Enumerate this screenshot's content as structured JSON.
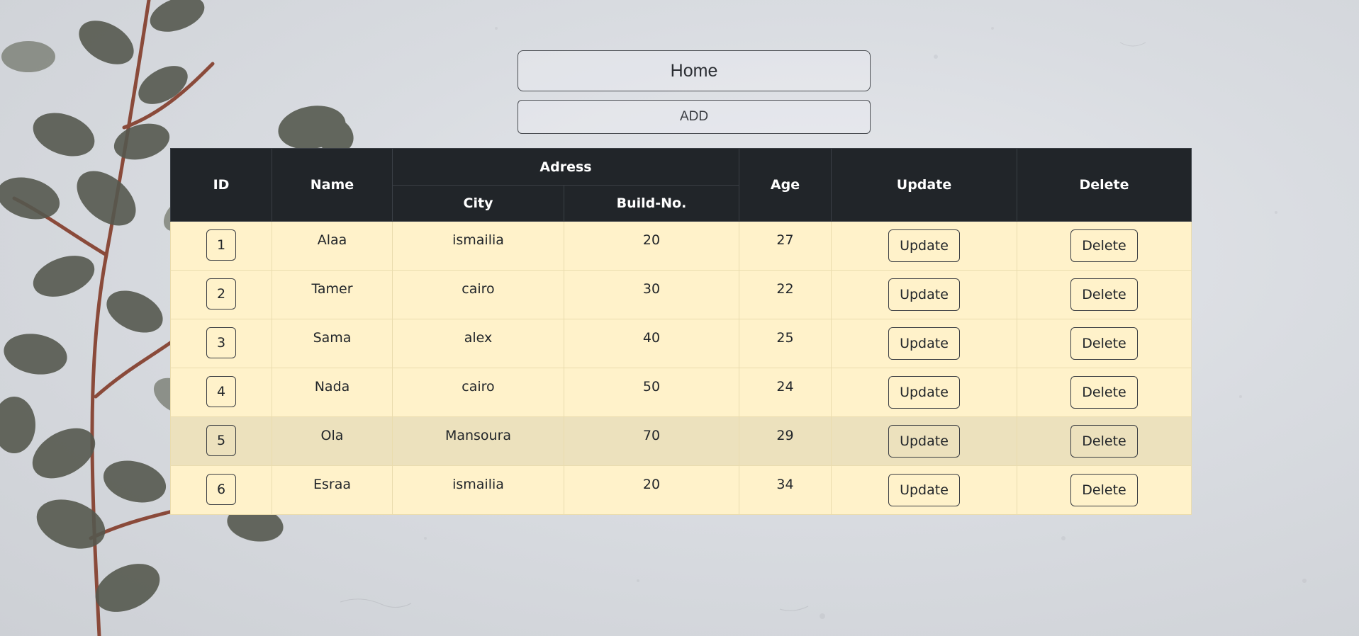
{
  "home_label": "Home",
  "add_label": "ADD",
  "table": {
    "headers": {
      "id": "ID",
      "name": "Name",
      "address": "Adress",
      "city": "City",
      "build_no": "Build-No.",
      "age": "Age",
      "update": "Update",
      "delete": "Delete"
    },
    "rows": [
      {
        "id": "1",
        "name": "Alaa",
        "city": "ismailia",
        "build_no": "20",
        "age": "27",
        "update": "Update",
        "delete": "Delete"
      },
      {
        "id": "2",
        "name": "Tamer",
        "city": "cairo",
        "build_no": "30",
        "age": "22",
        "update": "Update",
        "delete": "Delete"
      },
      {
        "id": "3",
        "name": "Sama",
        "city": "alex",
        "build_no": "40",
        "age": "25",
        "update": "Update",
        "delete": "Delete"
      },
      {
        "id": "4",
        "name": "Nada",
        "city": "cairo",
        "build_no": "50",
        "age": "24",
        "update": "Update",
        "delete": "Delete"
      },
      {
        "id": "5",
        "name": "Ola",
        "city": "Mansoura",
        "build_no": "70",
        "age": "29",
        "update": "Update",
        "delete": "Delete"
      },
      {
        "id": "6",
        "name": "Esraa",
        "city": "ismailia",
        "build_no": "20",
        "age": "34",
        "update": "Update",
        "delete": "Delete"
      }
    ]
  },
  "colors": {
    "header_bg": "#212529",
    "row_bg": "#fff2ca",
    "row_hover_bg": "#ece1bd"
  },
  "background": {
    "description_icon": "concrete-texture",
    "decoration_icon": "eucalyptus-branch-icon"
  }
}
